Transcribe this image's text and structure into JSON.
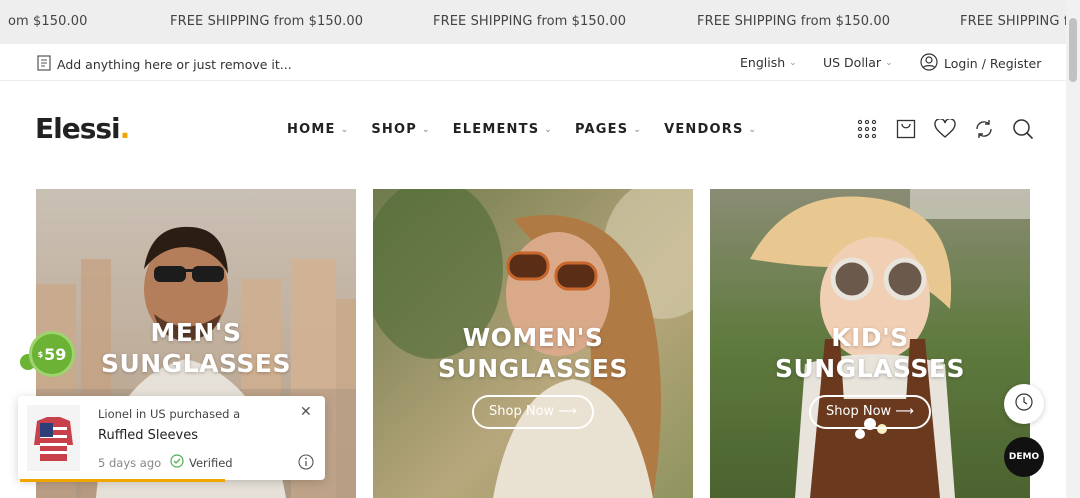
{
  "announcement": {
    "messages": [
      "om $150.00",
      "FREE SHIPPING from $150.00",
      "FREE SHIPPING from $150.00",
      "FREE SHIPPING from $150.00",
      "FREE SHIPPING f"
    ]
  },
  "topbar": {
    "note": "Add anything here or just remove it...",
    "language": "English",
    "currency": "US Dollar",
    "login": "Login / Register"
  },
  "header": {
    "logo": "Elessi",
    "logo_dot": ".",
    "nav": [
      "HOME",
      "SHOP",
      "ELEMENTS",
      "PAGES",
      "VENDORS"
    ]
  },
  "banners": [
    {
      "title_line1": "MEN'S",
      "title_line2": "SUNGLASSES",
      "button": ""
    },
    {
      "title_line1": "WOMEN'S",
      "title_line2": "SUNGLASSES",
      "button": "Shop Now ⟶"
    },
    {
      "title_line1": "KID'S",
      "title_line2": "SUNGLASSES",
      "button": "Shop Now ⟶"
    }
  ],
  "badge": {
    "currency": "$",
    "price": "59"
  },
  "popup": {
    "line1": "Lionel in US purchased a",
    "product": "Ruffled Sleeves",
    "time_ago": "5 days ago",
    "verified": "Verified"
  },
  "fab": {
    "demo": "DEMO"
  },
  "colors": {
    "accent": "#f0a500",
    "badge_green": "#6bb235"
  }
}
